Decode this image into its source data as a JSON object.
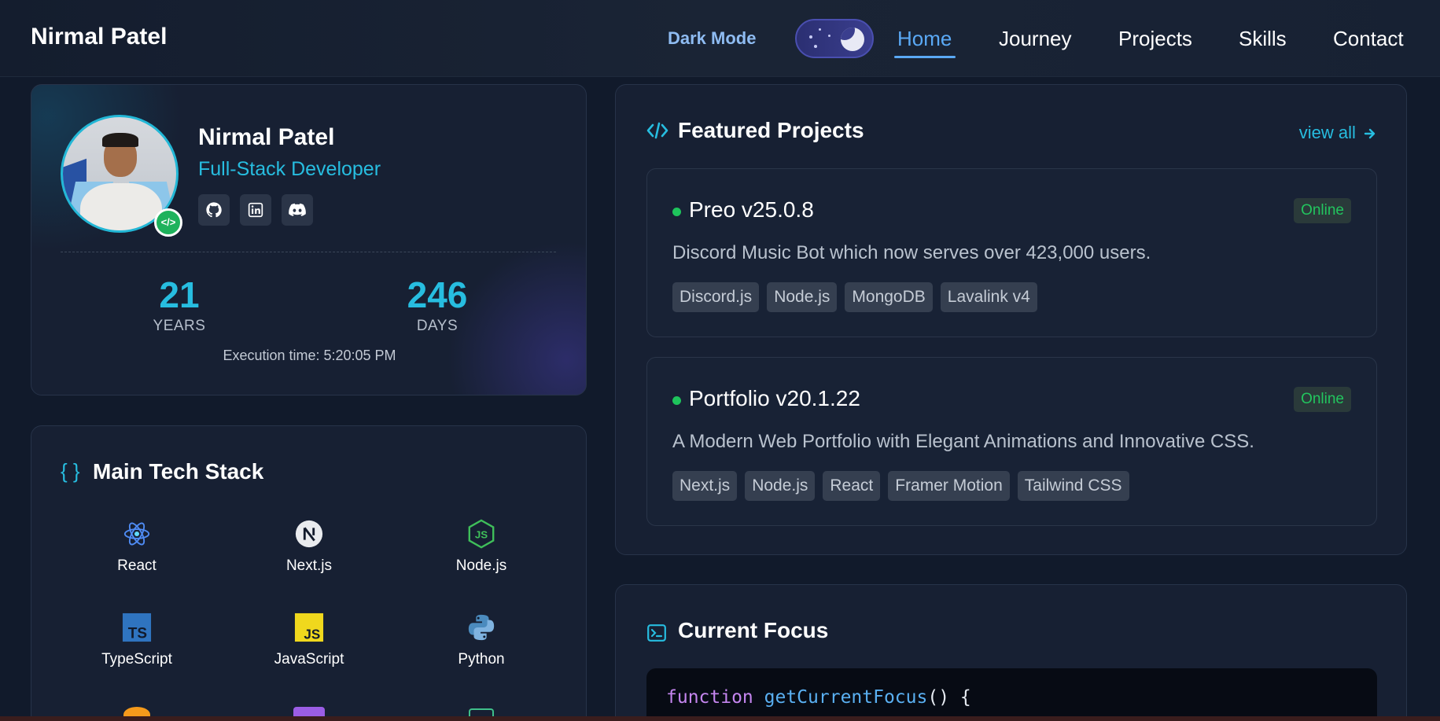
{
  "nav": {
    "brand": "Nirmal Patel",
    "dark_mode_label": "Dark Mode",
    "links": [
      "Home",
      "Journey",
      "Projects",
      "Skills",
      "Contact"
    ],
    "active": "Home"
  },
  "profile": {
    "name": "Nirmal Patel",
    "role": "Full-Stack Developer",
    "badge": "</>",
    "socials": [
      "github-icon",
      "linkedin-icon",
      "discord-icon"
    ],
    "stats": [
      {
        "value": "21",
        "label": "YEARS"
      },
      {
        "value": "246",
        "label": "DAYS"
      }
    ],
    "execution": "Execution time: 5:20:05 PM"
  },
  "tech": {
    "title_icon": "{ }",
    "title": "Main Tech Stack",
    "items": [
      "React",
      "Next.js",
      "Node.js",
      "TypeScript",
      "JavaScript",
      "Python"
    ]
  },
  "projects": {
    "title": "Featured Projects",
    "view_all": "view all",
    "items": [
      {
        "name": "Preo v25.0.8",
        "status": "Online",
        "desc": "Discord Music Bot which now serves over 423,000 users.",
        "tags": [
          "Discord.js",
          "Node.js",
          "MongoDB",
          "Lavalink v4"
        ]
      },
      {
        "name": "Portfolio v20.1.22",
        "status": "Online",
        "desc": "A Modern Web Portfolio with Elegant Animations and Innovative CSS.",
        "tags": [
          "Next.js",
          "Node.js",
          "React",
          "Framer Motion",
          "Tailwind CSS"
        ]
      }
    ]
  },
  "focus": {
    "title": "Current Focus",
    "code_keyword": "function",
    "code_fn": "getCurrentFocus",
    "code_rest": "() {"
  },
  "colors": {
    "accent": "#27bde0",
    "online": "#22c55e",
    "nav_active": "#5aa9f5"
  }
}
